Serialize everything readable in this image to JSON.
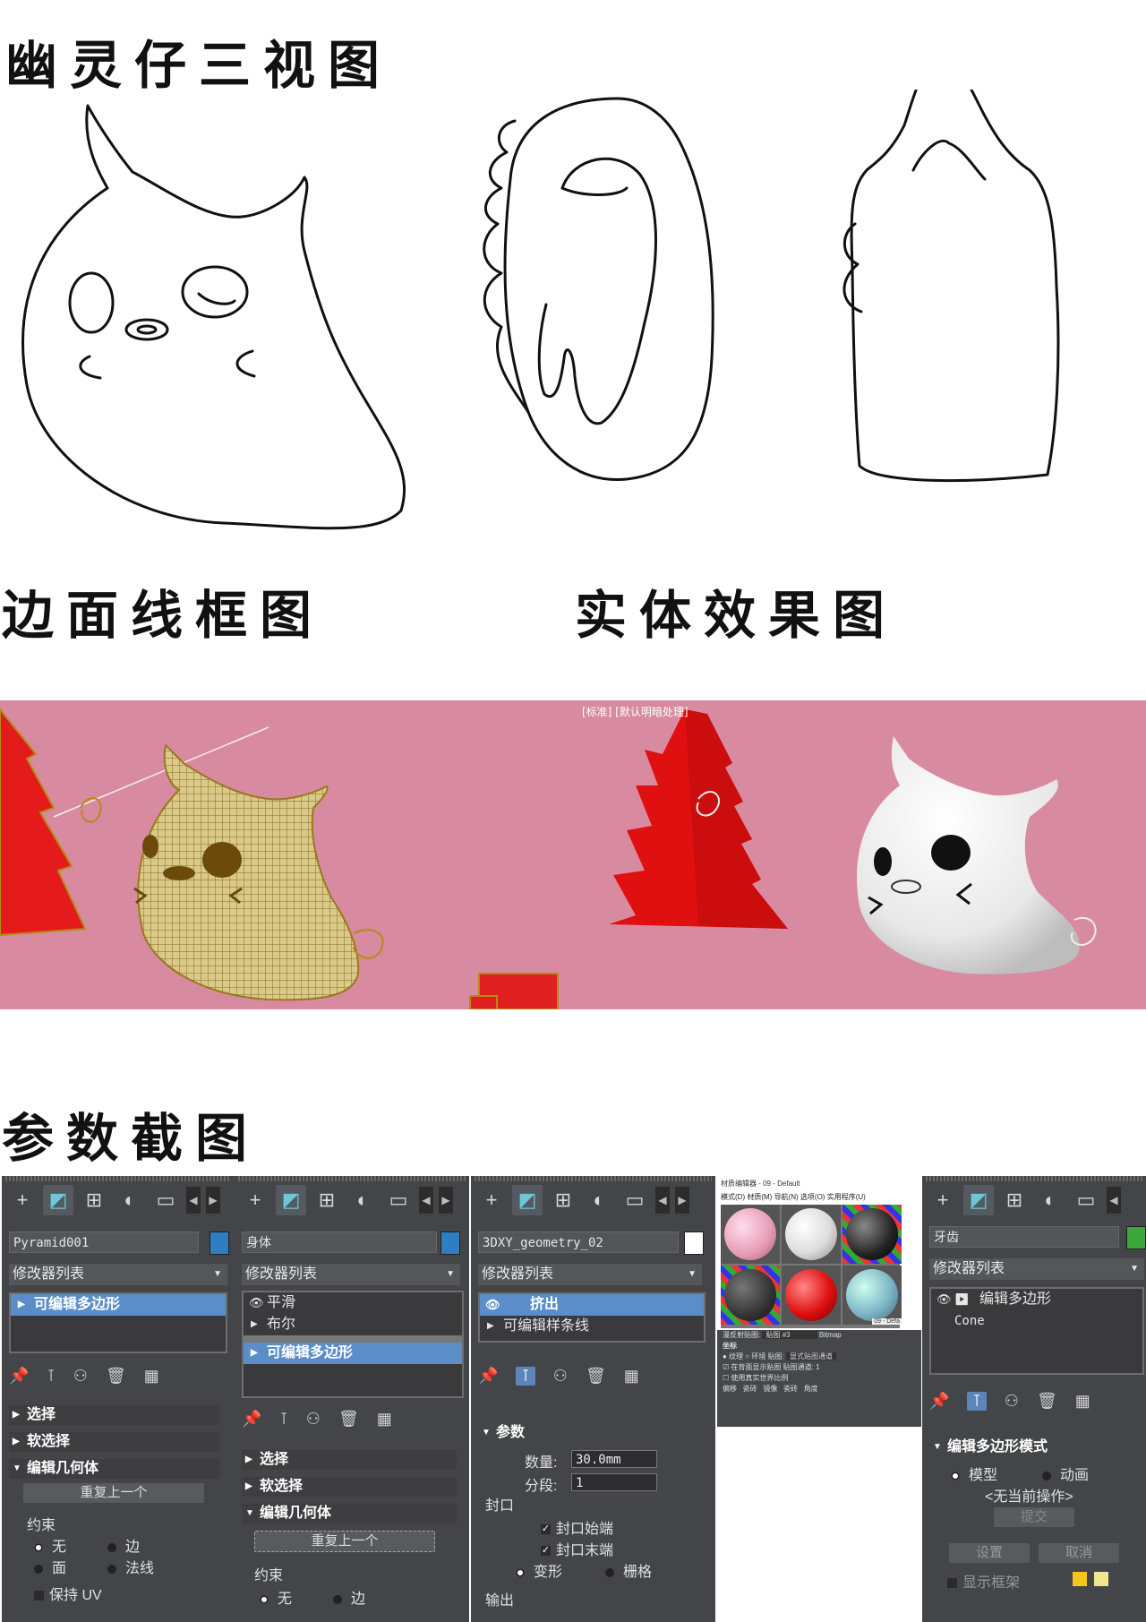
{
  "headings": {
    "three_view": "幽灵仔三视图",
    "wireframe": "边面线框图",
    "solid": "实体效果图",
    "params": "参数截图"
  },
  "viewport": {
    "label": "[标准] [默认明暗处理]"
  },
  "panels": [
    {
      "object_name": "Pyramid001",
      "swatch_color": "#2e7ec4",
      "modifier_list": "修改器列表",
      "stack": [
        {
          "label": "可编辑多边形",
          "selected": true,
          "type": "tri"
        }
      ],
      "rollouts": [
        {
          "label": "选择",
          "open": false
        },
        {
          "label": "软选择",
          "open": false
        },
        {
          "label": "编辑几何体",
          "open": true
        }
      ],
      "repeat_last": "重复上一个",
      "constraint_label": "约束",
      "constraints": [
        {
          "label": "无",
          "on": true
        },
        {
          "label": "边",
          "on": false
        },
        {
          "label": "面",
          "on": false
        },
        {
          "label": "法线",
          "on": false
        }
      ],
      "cut_label": "保持 UV"
    },
    {
      "object_name": "身体",
      "swatch_color": "#2e7ec4",
      "modifier_list": "修改器列表",
      "stack": [
        {
          "label": "平滑",
          "selected": false,
          "type": "eye"
        },
        {
          "label": "布尔",
          "selected": false,
          "type": "tri"
        },
        {
          "label": "可编辑多边形",
          "selected": true,
          "type": "tri"
        }
      ],
      "rollouts": [
        {
          "label": "选择",
          "open": false
        },
        {
          "label": "软选择",
          "open": false
        },
        {
          "label": "编辑几何体",
          "open": true
        }
      ],
      "repeat_last": "重复上一个",
      "constraint_label": "约束",
      "constraints": [
        {
          "label": "无",
          "on": true
        },
        {
          "label": "边",
          "on": false
        }
      ]
    },
    {
      "object_name": "3DXY_geometry_02",
      "swatch_color": "#ffffff",
      "modifier_list": "修改器列表",
      "stack": [
        {
          "label": "挤出",
          "selected": true,
          "type": "eye"
        },
        {
          "label": "可编辑样条线",
          "selected": false,
          "type": "tri"
        }
      ],
      "rollout": "参数",
      "amount_label": "数量:",
      "amount_value": "30.0mm",
      "segments_label": "分段:",
      "segments_value": "1",
      "cap_label": "封口",
      "cap_start": "封口始端",
      "cap_end": "封口末端",
      "morph": "变形",
      "grid": "栅格",
      "output": "输出"
    },
    {
      "object_name": "牙齿",
      "swatch_color": "#3aa83a",
      "modifier_list": "修改器列表",
      "stack": [
        {
          "label": "编辑多边形",
          "selected": false,
          "type": "eye"
        },
        {
          "label": "Cone",
          "selected": false,
          "type": "plain"
        }
      ],
      "rollout": "编辑多边形模式",
      "mode_model": "模型",
      "mode_anim": "动画",
      "no_op": "<无当前操作>",
      "commit": "提交",
      "settings": "设置",
      "cancel": "取消",
      "show_cage": "显示框架"
    }
  ],
  "material_editor": {
    "title": "材质编辑器 - 09 - Default",
    "menu": [
      "模式(D)",
      "材质(M)",
      "导航(N)",
      "选项(O)",
      "实用程序(U)"
    ],
    "slot_name": "09 - Defa",
    "map_label": "漫反射贴图:",
    "map_name": "贴图 #3",
    "map_type": "Bitmap",
    "coords_label": "坐标",
    "tex_label": "纹理",
    "env_label": "环境",
    "mapping_label": "贴图:",
    "mapping_value": "显式贴图通道",
    "rows": [
      "在背面显示贴图",
      "使用真实世界比例"
    ],
    "channel_label": "贴图通道:",
    "channel_value": "1",
    "col_labels": [
      "偏移",
      "瓷砖",
      "镜像",
      "瓷砖",
      "角度"
    ]
  }
}
